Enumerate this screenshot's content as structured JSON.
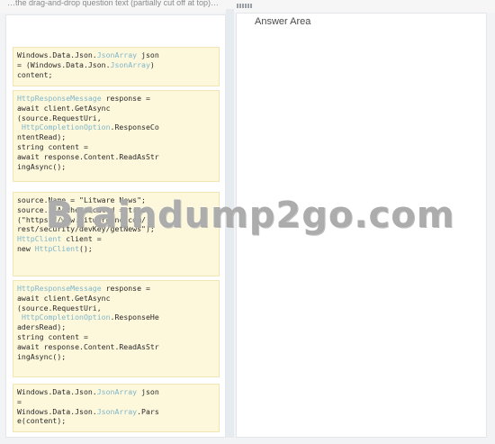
{
  "header": {
    "caption": "…the drag-and-drop question text (partially cut off at top)…"
  },
  "answer_area": {
    "title": "Answer Area"
  },
  "snippets": [
    {
      "lines": [
        [
          [
            "Windows.Data.Json.",
            ""
          ],
          [
            "JsonArray",
            "t"
          ],
          [
            " json",
            ""
          ]
        ],
        [
          [
            "= (Windows.Data.Json.",
            ""
          ],
          [
            "JsonArray",
            "t"
          ],
          [
            ")",
            ""
          ]
        ],
        [
          [
            "content;",
            ""
          ]
        ]
      ]
    },
    {
      "lines": [
        [
          [
            "HttpResponseMessage",
            "t"
          ],
          [
            " response =",
            ""
          ]
        ],
        [
          [
            "await client.GetAsync",
            ""
          ]
        ],
        [
          [
            "(source.RequestUri,",
            ""
          ]
        ],
        [
          [
            " ",
            ""
          ],
          [
            "HttpCompletionOption",
            "t"
          ],
          [
            ".ResponseCo",
            ""
          ]
        ],
        [
          [
            "ntentRead);",
            ""
          ]
        ],
        [
          [
            "string content =",
            ""
          ]
        ],
        [
          [
            "await response.Content.ReadAsStr",
            ""
          ]
        ],
        [
          [
            "ingAsync();",
            ""
          ]
        ]
      ]
    },
    {
      "lines": [
        [
          [
            "source.Name = \"Litware News\";",
            ""
          ]
        ],
        [
          [
            "source.IsAuthenticated = true;",
            ""
          ]
        ],
        [
          [
            "(\"https://www.litwareinc.com/",
            ""
          ]
        ],
        [
          [
            "rest/security/devKey/getNews\");",
            ""
          ]
        ],
        [
          [
            "HttpClient",
            "t"
          ],
          [
            " client =",
            ""
          ]
        ],
        [
          [
            "new ",
            ""
          ],
          [
            "HttpClient",
            "t"
          ],
          [
            "();",
            ""
          ]
        ]
      ]
    },
    {
      "lines": [
        [
          [
            "HttpResponseMessage",
            "t"
          ],
          [
            " response =",
            ""
          ]
        ],
        [
          [
            "await client.GetAsync",
            ""
          ]
        ],
        [
          [
            "(source.RequestUri,",
            ""
          ]
        ],
        [
          [
            " ",
            ""
          ],
          [
            "HttpCompletionOption",
            "t"
          ],
          [
            ".ResponseHe",
            ""
          ]
        ],
        [
          [
            "adersRead);",
            ""
          ]
        ],
        [
          [
            "string content =",
            ""
          ]
        ],
        [
          [
            "await response.Content.ReadAsStr",
            ""
          ]
        ],
        [
          [
            "ingAsync();",
            ""
          ]
        ]
      ]
    },
    {
      "lines": [
        [
          [
            "Windows.Data.Json.",
            ""
          ],
          [
            "JsonArray",
            "t"
          ],
          [
            " json",
            ""
          ]
        ],
        [
          [
            "=",
            ""
          ]
        ],
        [
          [
            "Windows.Data.Json.",
            ""
          ],
          [
            "JsonArray",
            "t"
          ],
          [
            ".Pars",
            ""
          ]
        ],
        [
          [
            "e(content);",
            ""
          ]
        ]
      ]
    }
  ],
  "watermark": {
    "text": "Braindump2go.com"
  },
  "colors": {
    "type_name": "#7fb6c9",
    "snippet_bg": "#fdf8dc",
    "snippet_border": "#f0e6b4"
  }
}
